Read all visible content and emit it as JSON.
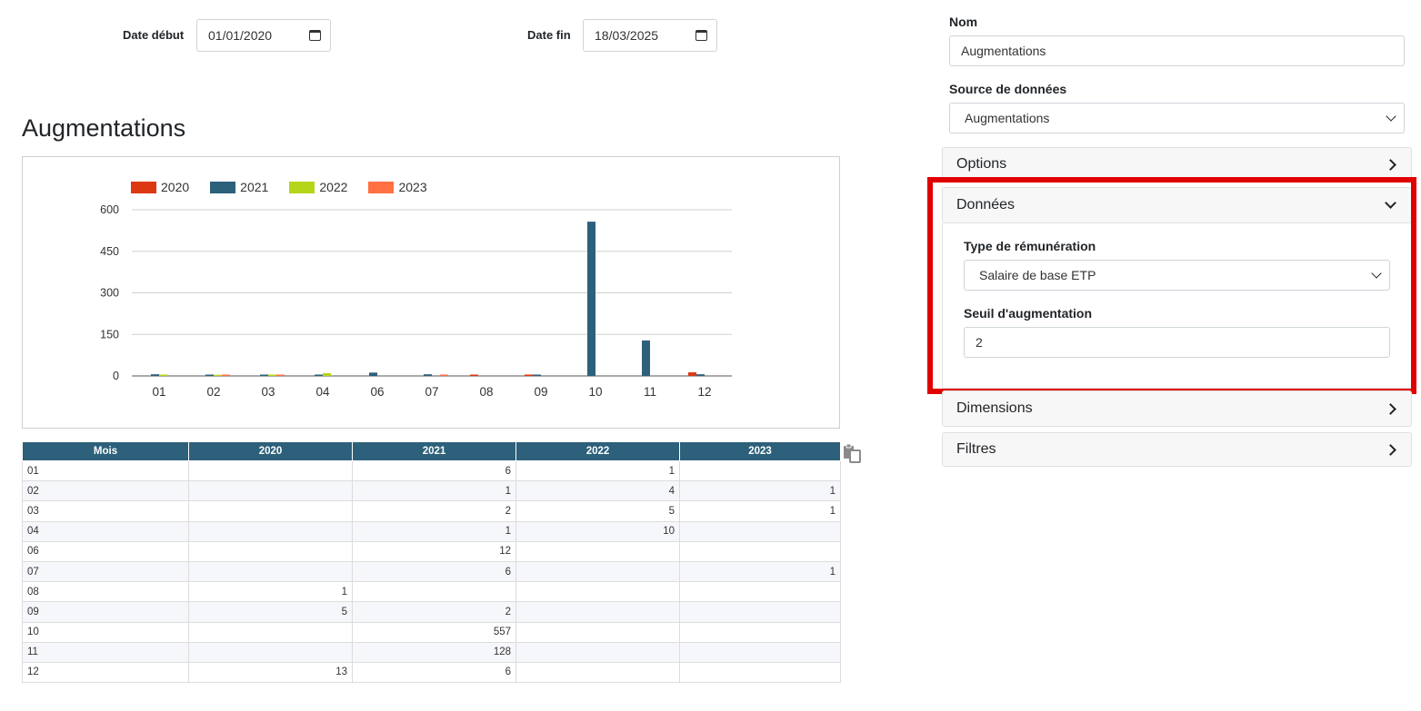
{
  "filters": {
    "start_label": "Date début",
    "start_value": "01/01/2020",
    "end_label": "Date fin",
    "end_value": "18/03/2025"
  },
  "page_title": "Augmentations",
  "colors": {
    "2020": "#dc3912",
    "2021": "#2d607a",
    "2022": "#b5d519",
    "2023": "#ff7043",
    "header": "#2d607a",
    "highlight": "#e00000"
  },
  "chart_data": {
    "type": "bar",
    "categories": [
      "01",
      "02",
      "03",
      "04",
      "06",
      "07",
      "08",
      "09",
      "10",
      "11",
      "12"
    ],
    "series": [
      {
        "name": "2020",
        "values": [
          null,
          null,
          null,
          null,
          null,
          null,
          1,
          5,
          null,
          null,
          13
        ]
      },
      {
        "name": "2021",
        "values": [
          6,
          1,
          2,
          1,
          12,
          6,
          null,
          2,
          557,
          128,
          6
        ]
      },
      {
        "name": "2022",
        "values": [
          1,
          4,
          5,
          10,
          null,
          null,
          null,
          null,
          null,
          null,
          null
        ]
      },
      {
        "name": "2023",
        "values": [
          null,
          1,
          1,
          null,
          null,
          1,
          null,
          null,
          null,
          null,
          null
        ]
      }
    ],
    "yticks": [
      "600",
      "450",
      "300",
      "150",
      "0"
    ],
    "ylim": [
      0,
      600
    ],
    "grid": true,
    "legend_position": "top-left"
  },
  "table": {
    "headers": [
      "Mois",
      "2020",
      "2021",
      "2022",
      "2023"
    ],
    "rows": [
      [
        "01",
        "",
        "6",
        "1",
        ""
      ],
      [
        "02",
        "",
        "1",
        "4",
        "1"
      ],
      [
        "03",
        "",
        "2",
        "5",
        "1"
      ],
      [
        "04",
        "",
        "1",
        "10",
        ""
      ],
      [
        "06",
        "",
        "12",
        "",
        ""
      ],
      [
        "07",
        "",
        "6",
        "",
        "1"
      ],
      [
        "08",
        "1",
        "",
        "",
        ""
      ],
      [
        "09",
        "5",
        "2",
        "",
        ""
      ],
      [
        "10",
        "",
        "557",
        "",
        ""
      ],
      [
        "11",
        "",
        "128",
        "",
        ""
      ],
      [
        "12",
        "13",
        "6",
        "",
        ""
      ]
    ],
    "copy_icon": "copy-icon"
  },
  "panel": {
    "name_label": "Nom",
    "name_value": "Augmentations",
    "source_label": "Source de données",
    "source_value": "Augmentations",
    "sections": {
      "options": "Options",
      "donnees": "Données",
      "dimensions": "Dimensions",
      "filtres": "Filtres"
    },
    "donnees": {
      "type_label": "Type de rémunération",
      "type_value": "Salaire de base ETP",
      "seuil_label": "Seuil d'augmentation",
      "seuil_value": "2"
    }
  }
}
